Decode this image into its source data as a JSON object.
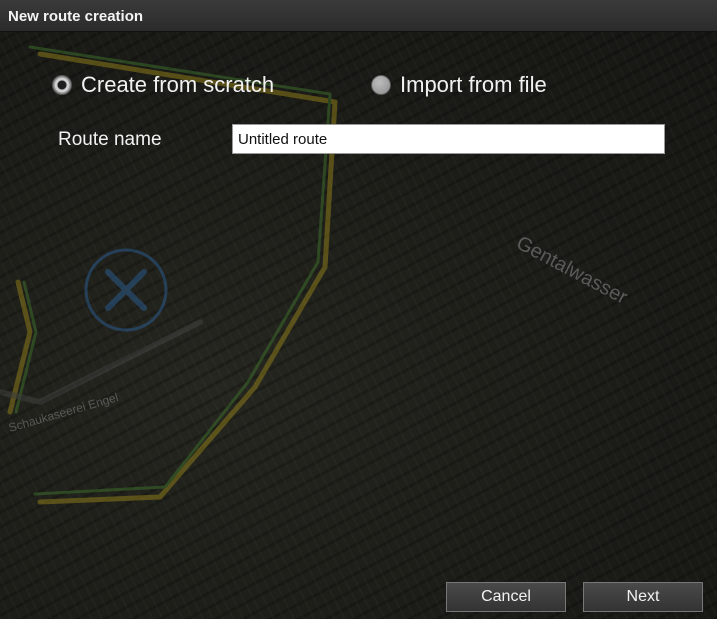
{
  "dialog": {
    "title": "New route creation"
  },
  "options": {
    "create_from_scratch": {
      "label": "Create from scratch",
      "selected": true
    },
    "import_from_file": {
      "label": "Import from file",
      "selected": false
    }
  },
  "route_name": {
    "label": "Route name",
    "value": "Untitled route"
  },
  "buttons": {
    "cancel_label": "Cancel",
    "next_label": "Next"
  },
  "map": {
    "street_labels": [
      "Gentalwasser",
      "Schaukaseerei Engel"
    ]
  }
}
